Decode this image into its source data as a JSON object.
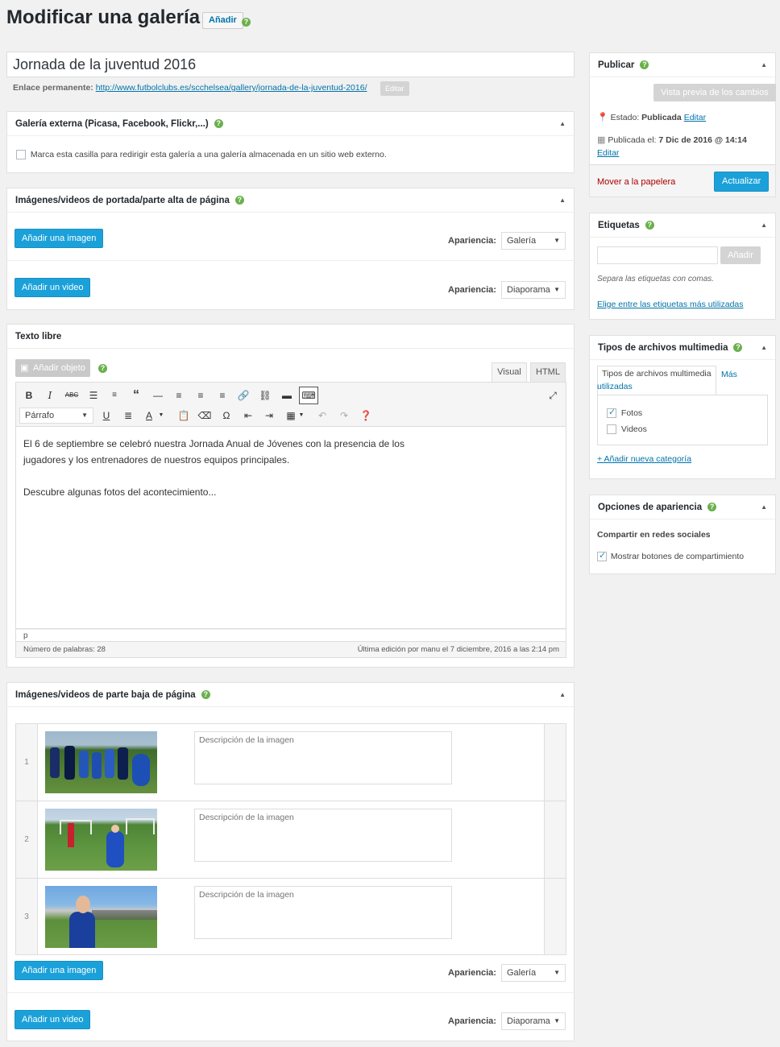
{
  "page": {
    "title": "Modificar una galería",
    "add_button": "Añadir"
  },
  "post": {
    "title_value": "Jornada de la juventud 2016",
    "permalink_label": "Enlace permanente:",
    "permalink_url": "http://www.futbolclubs.es/scchelsea/gallery/jornada-de-la-juventud-2016/",
    "permalink_edit": "Editar"
  },
  "external_gallery": {
    "title": "Galería externa (Picasa, Facebook, Flickr,...)",
    "checkbox_label": "Marca esta casilla para redirigir esta galería a una galería almacenada en un sitio web externo."
  },
  "top_media": {
    "title": "Imágenes/videos de portada/parte alta de página",
    "add_image": "Añadir una imagen",
    "add_video": "Añadir un video",
    "appearance_label": "Apariencia:",
    "image_appearance": "Galería",
    "video_appearance": "Diaporama"
  },
  "free_text": {
    "title": "Texto libre",
    "add_object": "Añadir objeto",
    "tab_visual": "Visual",
    "tab_html": "HTML",
    "format_select": "Párrafo",
    "paragraph1_line1": "El 6 de septiembre se celebró nuestra Jornada Anual de Jóvenes con la presencia de los",
    "paragraph1_line2": "jugadores y los entrenadores de nuestros equipos principales.",
    "paragraph2": "Descubre algunas fotos del acontecimiento...",
    "path": "p",
    "word_count": "Número de palabras: 28",
    "last_edit": "Última edición por manu el 7 diciembre, 2016 a las 2:14 pm"
  },
  "bottom_media": {
    "title": "Imágenes/videos de parte baja de página",
    "rows": [
      {
        "num": "1",
        "placeholder": "Descripción de la imagen"
      },
      {
        "num": "2",
        "placeholder": "Descripción de la imagen"
      },
      {
        "num": "3",
        "placeholder": "Descripción de la imagen"
      }
    ],
    "add_image": "Añadir una imagen",
    "add_video": "Añadir un video",
    "appearance_label": "Apariencia:",
    "image_appearance": "Galería",
    "video_appearance": "Diaporama"
  },
  "publish": {
    "title": "Publicar",
    "preview": "Vista previa de los cambios",
    "status_label": "Estado:",
    "status_value": "Publicada",
    "status_edit": "Editar",
    "published_label": "Publicada el:",
    "published_value": "7 Dic de 2016 @ 14:14",
    "published_edit": "Editar",
    "trash": "Mover a la papelera",
    "update": "Actualizar"
  },
  "tags": {
    "title": "Etiquetas",
    "add": "Añadir",
    "hint": "Separa las etiquetas con comas.",
    "choose_link": "Elige entre las etiquetas más utilizadas"
  },
  "media_types": {
    "title": "Tipos de archivos multimedia",
    "tab_all": "Tipos de archivos multimedia",
    "tab_most_line1": "Más",
    "tab_most_line2": "utilizadas",
    "items": [
      {
        "label": "Fotos",
        "checked": true
      },
      {
        "label": "Videos",
        "checked": false
      }
    ],
    "add_category": "+ Añadir nueva categoría"
  },
  "appearance_options": {
    "title": "Opciones de apariencia",
    "subtitle": "Compartir en redes sociales",
    "checkbox_label": "Mostrar botones de compartimiento"
  },
  "colors": {
    "accent_blue": "#1ba1d9",
    "help_green": "#6ab04c",
    "link": "#0073aa",
    "trash_red": "#a00"
  }
}
